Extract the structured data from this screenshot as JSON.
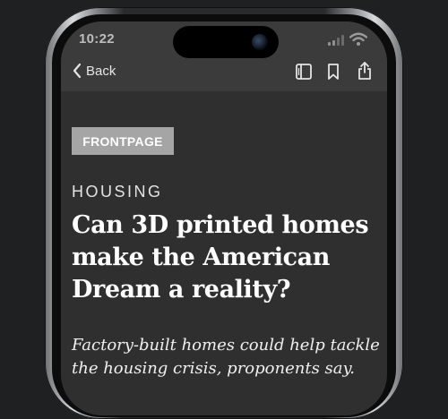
{
  "status_bar": {
    "time": "10:22"
  },
  "nav": {
    "back_label": "Back"
  },
  "article": {
    "badge": "FRONTPAGE",
    "section": "HOUSING",
    "headline": "Can 3D printed homes make the American Dream a reality?",
    "subheadline": "Factory-built homes could help tackle the housing crisis, proponents say."
  },
  "icons": {
    "back": "chevron-left-icon",
    "reader_view": "reader-view-icon",
    "bookmark": "bookmark-icon",
    "share": "share-icon",
    "signal": "signal-icon",
    "wifi": "wifi-icon"
  },
  "colors": {
    "background": "#1f2022",
    "toolbar": "#3b3b3c",
    "content": "#2f2f30",
    "badge": "#a5a5a5"
  }
}
